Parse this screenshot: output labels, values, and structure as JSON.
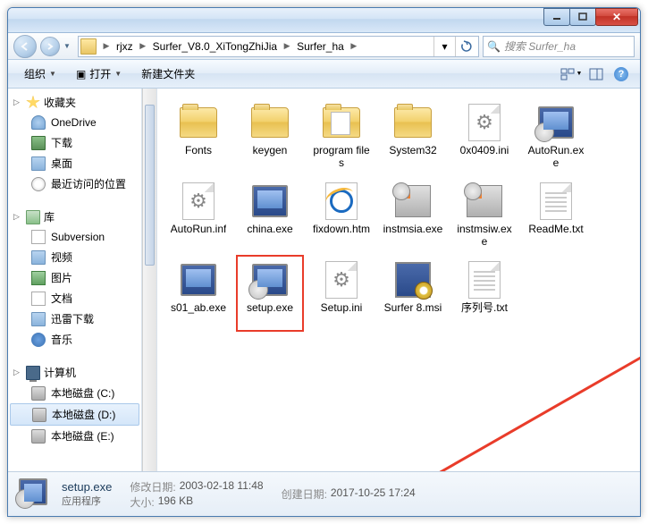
{
  "window": {
    "breadcrumb": [
      "rjxz",
      "Surfer_V8.0_XiTongZhiJia",
      "Surfer_ha"
    ],
    "search_placeholder": "搜索 Surfer_ha"
  },
  "toolbar": {
    "organize": "组织",
    "open": "打开",
    "new_folder": "新建文件夹"
  },
  "sidebar": {
    "favorites": {
      "label": "收藏夹",
      "items": [
        "OneDrive",
        "下载",
        "桌面",
        "最近访问的位置"
      ]
    },
    "libraries": {
      "label": "库",
      "items": [
        "Subversion",
        "视频",
        "图片",
        "文档",
        "迅雷下载",
        "音乐"
      ]
    },
    "computer": {
      "label": "计算机",
      "items": [
        "本地磁盘 (C:)",
        "本地磁盘 (D:)",
        "本地磁盘 (E:)"
      ]
    },
    "selected_index": 1
  },
  "files": [
    {
      "name": "Fonts",
      "type": "folder"
    },
    {
      "name": "keygen",
      "type": "folder"
    },
    {
      "name": "program files",
      "type": "folder-doc"
    },
    {
      "name": "System32",
      "type": "folder"
    },
    {
      "name": "0x0409.ini",
      "type": "ini"
    },
    {
      "name": "AutoRun.exe",
      "type": "exe-setup"
    },
    {
      "name": "AutoRun.inf",
      "type": "ini"
    },
    {
      "name": "china.exe",
      "type": "exe"
    },
    {
      "name": "fixdown.htm",
      "type": "htm"
    },
    {
      "name": "instmsia.exe",
      "type": "inst"
    },
    {
      "name": "instmsiw.exe",
      "type": "inst"
    },
    {
      "name": "ReadMe.txt",
      "type": "txt"
    },
    {
      "name": "s01_ab.exe",
      "type": "exe"
    },
    {
      "name": "setup.exe",
      "type": "exe-setup",
      "highlighted": true
    },
    {
      "name": "Setup.ini",
      "type": "ini"
    },
    {
      "name": "Surfer 8.msi",
      "type": "msi"
    },
    {
      "name": "序列号.txt",
      "type": "txt"
    }
  ],
  "details": {
    "name": "setup.exe",
    "type": "应用程序",
    "mod_label": "修改日期:",
    "mod_value": "2003-02-18 11:48",
    "size_label": "大小:",
    "size_value": "196 KB",
    "create_label": "创建日期:",
    "create_value": "2017-10-25 17:24"
  }
}
